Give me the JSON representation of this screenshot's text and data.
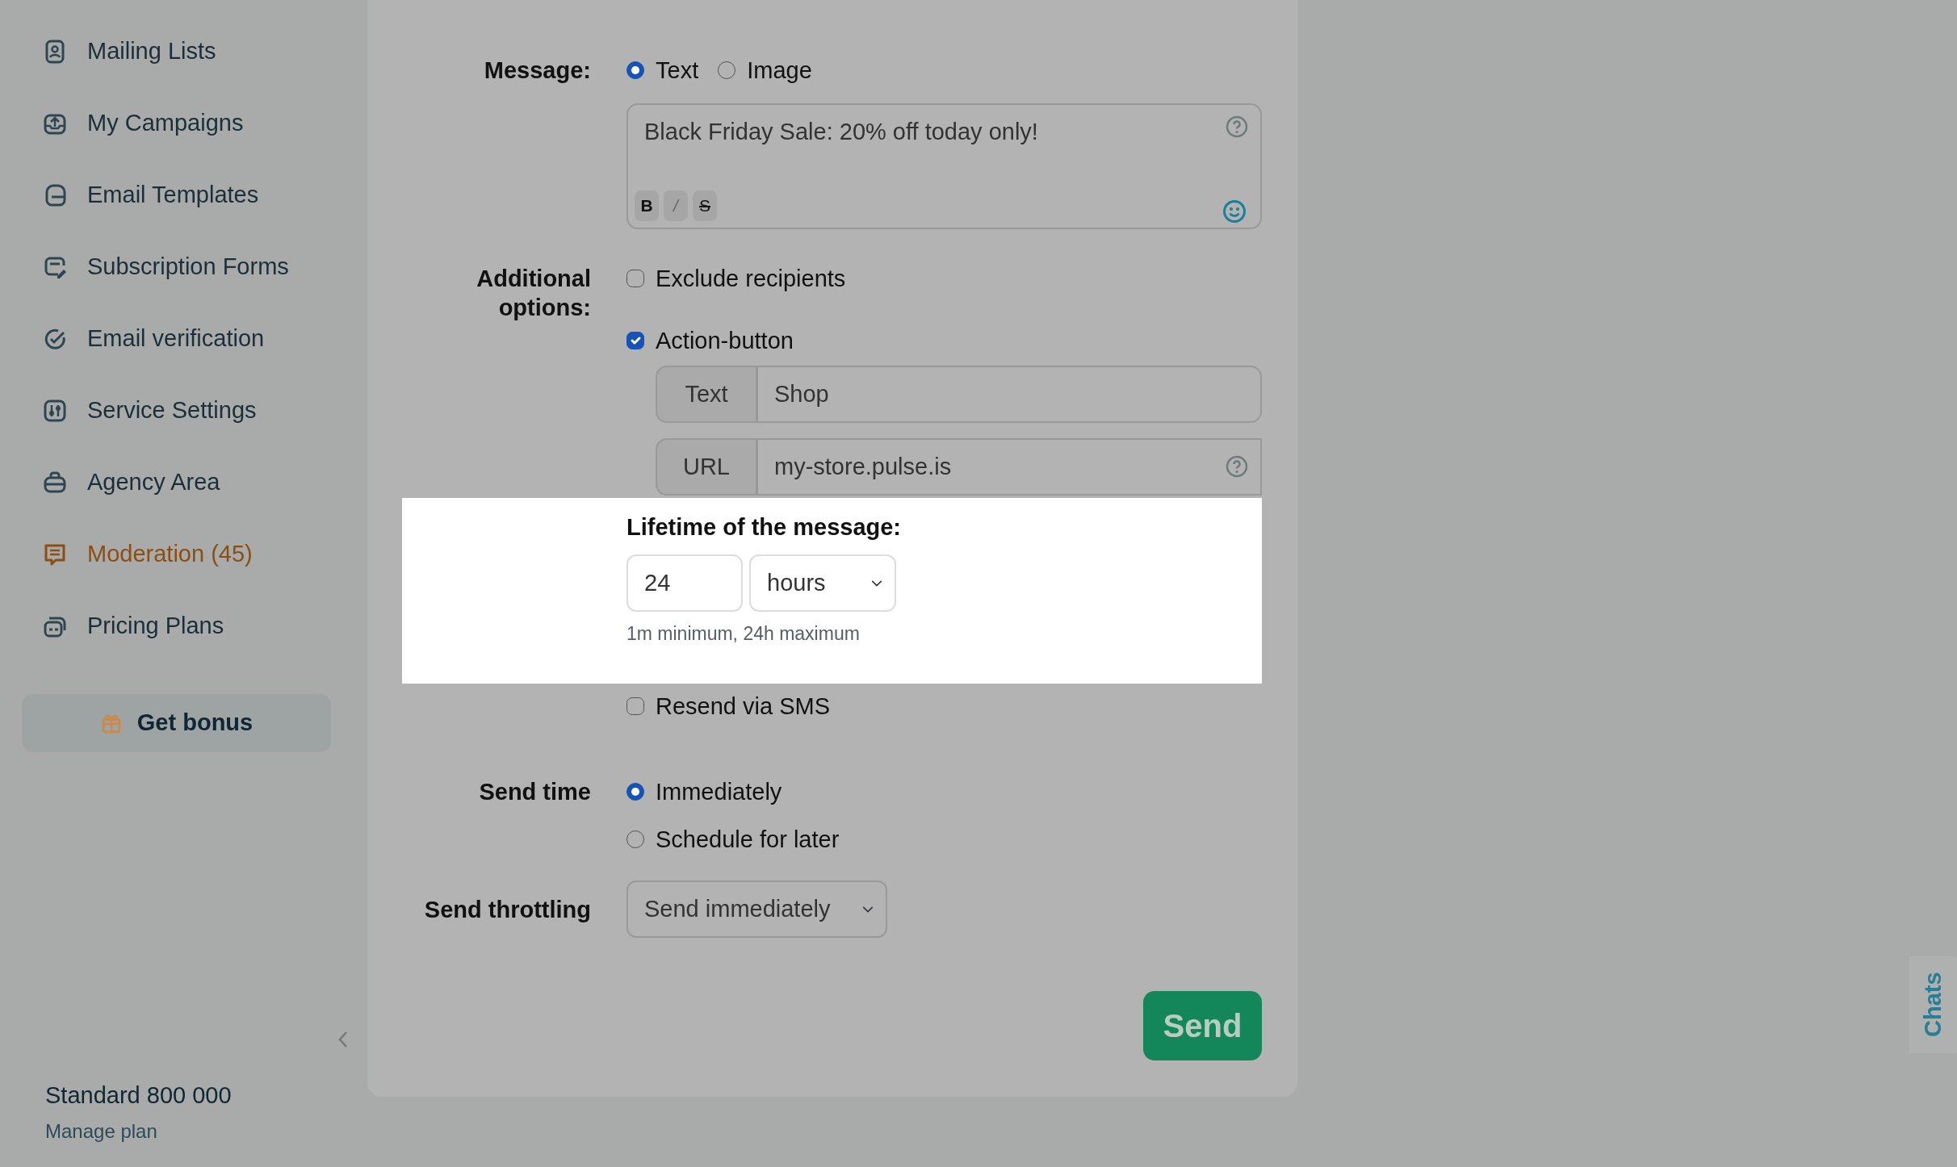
{
  "sidebar": {
    "items": [
      {
        "label": "Mailing Lists",
        "kind": "contacts",
        "color": "#1c2f38"
      },
      {
        "label": "My Campaigns",
        "kind": "campaign",
        "color": "#1c2f38"
      },
      {
        "label": "Email Templates",
        "kind": "templates",
        "color": "#1c2f38"
      },
      {
        "label": "Subscription Forms",
        "kind": "form",
        "color": "#1c2f38"
      },
      {
        "label": "Email verification",
        "kind": "verify",
        "color": "#1c2f38"
      },
      {
        "label": "Service Settings",
        "kind": "settings",
        "color": "#1c2f38"
      },
      {
        "label": "Agency Area",
        "kind": "agency",
        "color": "#1c2f38"
      },
      {
        "label": "Moderation (45)",
        "kind": "chat",
        "color": "#8a4f14"
      },
      {
        "label": "Pricing Plans",
        "kind": "pricing",
        "color": "#1c2f38"
      }
    ],
    "bonus_button": "Get bonus",
    "plan": {
      "name": "Standard 800 000",
      "link": "Manage plan"
    }
  },
  "form": {
    "message": {
      "label": "Message:",
      "options": [
        {
          "label": "Text",
          "selected": true
        },
        {
          "label": "Image",
          "selected": false
        }
      ],
      "text": "Black Friday Sale: 20% off today only!",
      "format_buttons": [
        {
          "label": "B",
          "kind": "bold"
        },
        {
          "label": "/",
          "kind": "italic"
        },
        {
          "label": "S",
          "kind": "strike"
        }
      ]
    },
    "additional": {
      "label": "Additional options:",
      "options": [
        {
          "label": "Exclude recipients",
          "checked": false
        },
        {
          "label": "Action-button",
          "checked": true
        }
      ],
      "fields": [
        {
          "addon": "Text",
          "value": "Shop",
          "help": false
        },
        {
          "addon": "URL",
          "value": "my-store.pulse.is",
          "help": true
        }
      ]
    },
    "lifetime": {
      "label": "Lifetime of the message:",
      "value": "24",
      "unit": "hours",
      "hint": "1m minimum, 24h maximum"
    },
    "resend": {
      "label": "Resend via SMS",
      "checked": false
    },
    "send_time": {
      "label": "Send time",
      "options": [
        {
          "label": "Immediately",
          "selected": true
        },
        {
          "label": "Schedule for later",
          "selected": false
        }
      ]
    },
    "throttling": {
      "label": "Send throttling",
      "value": "Send immediately"
    },
    "send_button": "Send"
  },
  "chats_tab": "Chats"
}
